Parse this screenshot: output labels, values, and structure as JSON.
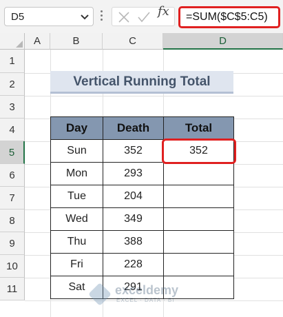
{
  "formula_bar": {
    "name_box": "D5",
    "fx_label": "fx",
    "formula": "=SUM($C$5:C5)",
    "icons": [
      "chevron-down-icon",
      "more-options-icon",
      "cancel-icon",
      "enter-icon",
      "insert-function-icon"
    ]
  },
  "columns": [
    "A",
    "B",
    "C",
    "D"
  ],
  "rows": [
    "1",
    "2",
    "3",
    "4",
    "5",
    "6",
    "7",
    "8",
    "9",
    "10",
    "11"
  ],
  "selected_cell": {
    "column": "D",
    "row": "5"
  },
  "title": "Vertical Running Total",
  "table": {
    "headers": [
      "Day",
      "Death",
      "Total"
    ],
    "rows": [
      [
        "Sun",
        "352",
        "352"
      ],
      [
        "Mon",
        "293",
        ""
      ],
      [
        "Tue",
        "204",
        ""
      ],
      [
        "Wed",
        "349",
        ""
      ],
      [
        "Thu",
        "388",
        ""
      ],
      [
        "Fri",
        "228",
        ""
      ],
      [
        "Sat",
        "291",
        ""
      ]
    ]
  },
  "watermark": {
    "name": "exceldemy",
    "tagline": "EXCEL · DATA · BI"
  },
  "colors": {
    "header_fill": "#8497b0",
    "title_fill": "#dfe5ef",
    "highlight": "#e02020",
    "selection": "#217346"
  }
}
